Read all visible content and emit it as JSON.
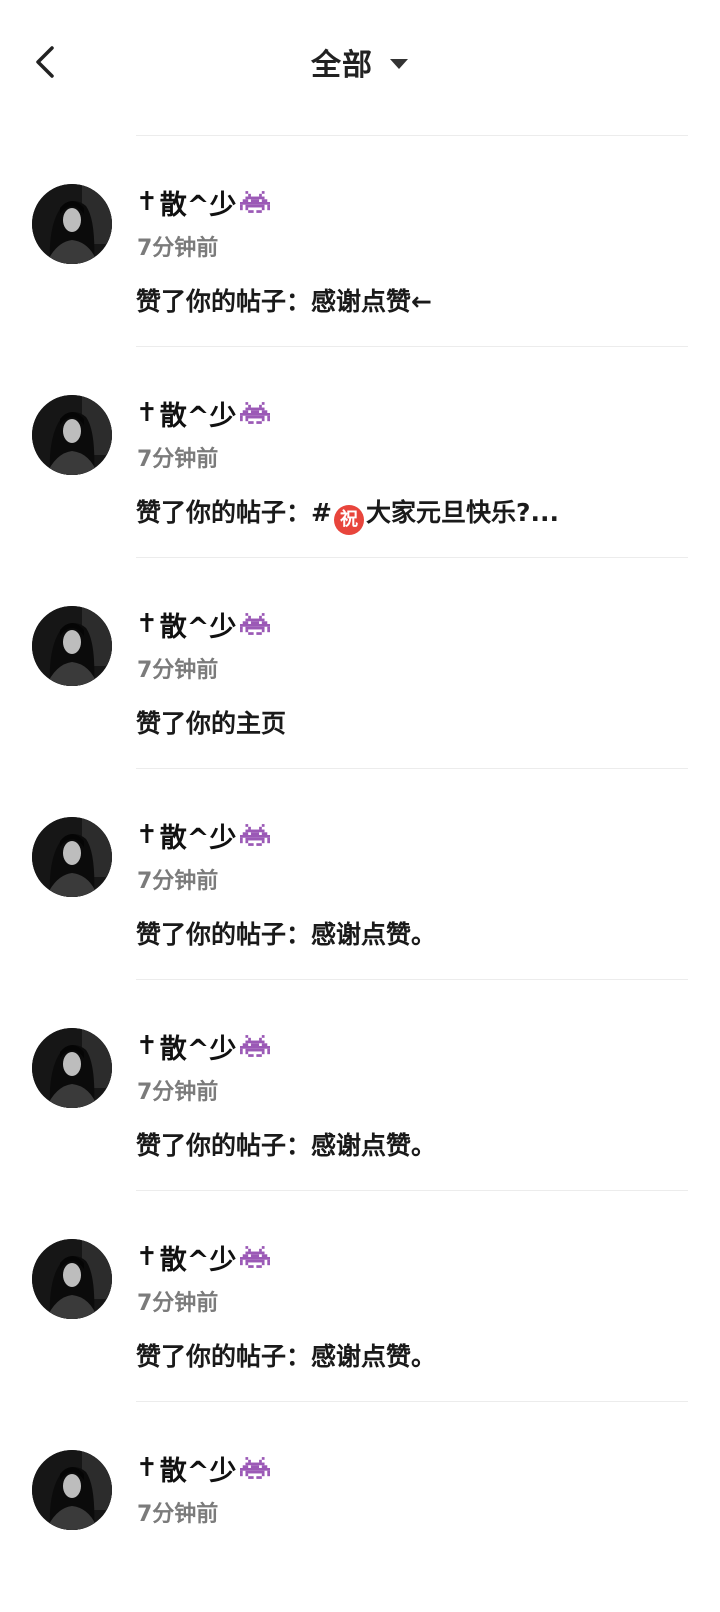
{
  "header": {
    "title": "全部"
  },
  "notifications": [
    {
      "name": "散^少",
      "time": "7分钟前",
      "prefix": "赞了你的帖子：",
      "body": "感谢点赞←",
      "has_blessing": false
    },
    {
      "name": "散^少",
      "time": "7分钟前",
      "prefix": "赞了你的帖子：",
      "body_before": "#",
      "blessing": "祝",
      "body": "大家元旦快乐?...",
      "has_blessing": true
    },
    {
      "name": "散^少",
      "time": "7分钟前",
      "prefix": "赞了你的主页",
      "body": "",
      "has_blessing": false
    },
    {
      "name": "散^少",
      "time": "7分钟前",
      "prefix": "赞了你的帖子：",
      "body": "感谢点赞。",
      "has_blessing": false
    },
    {
      "name": "散^少",
      "time": "7分钟前",
      "prefix": "赞了你的帖子：",
      "body": "感谢点赞。",
      "has_blessing": false
    },
    {
      "name": "散^少",
      "time": "7分钟前",
      "prefix": "赞了你的帖子：",
      "body": "感谢点赞。",
      "has_blessing": false
    },
    {
      "name": "散^少",
      "time": "7分钟前",
      "prefix": "",
      "body": "",
      "has_blessing": false
    }
  ],
  "icons": {
    "back": "chevron-left-icon",
    "dropdown": "caret-down-icon",
    "name_prefix": "cross-icon",
    "name_suffix": "alien-monster-icon"
  },
  "colors": {
    "divider": "#ececec",
    "time": "#7b7b7b",
    "alien": "#9b59b6",
    "blessing": "#e8453c"
  }
}
